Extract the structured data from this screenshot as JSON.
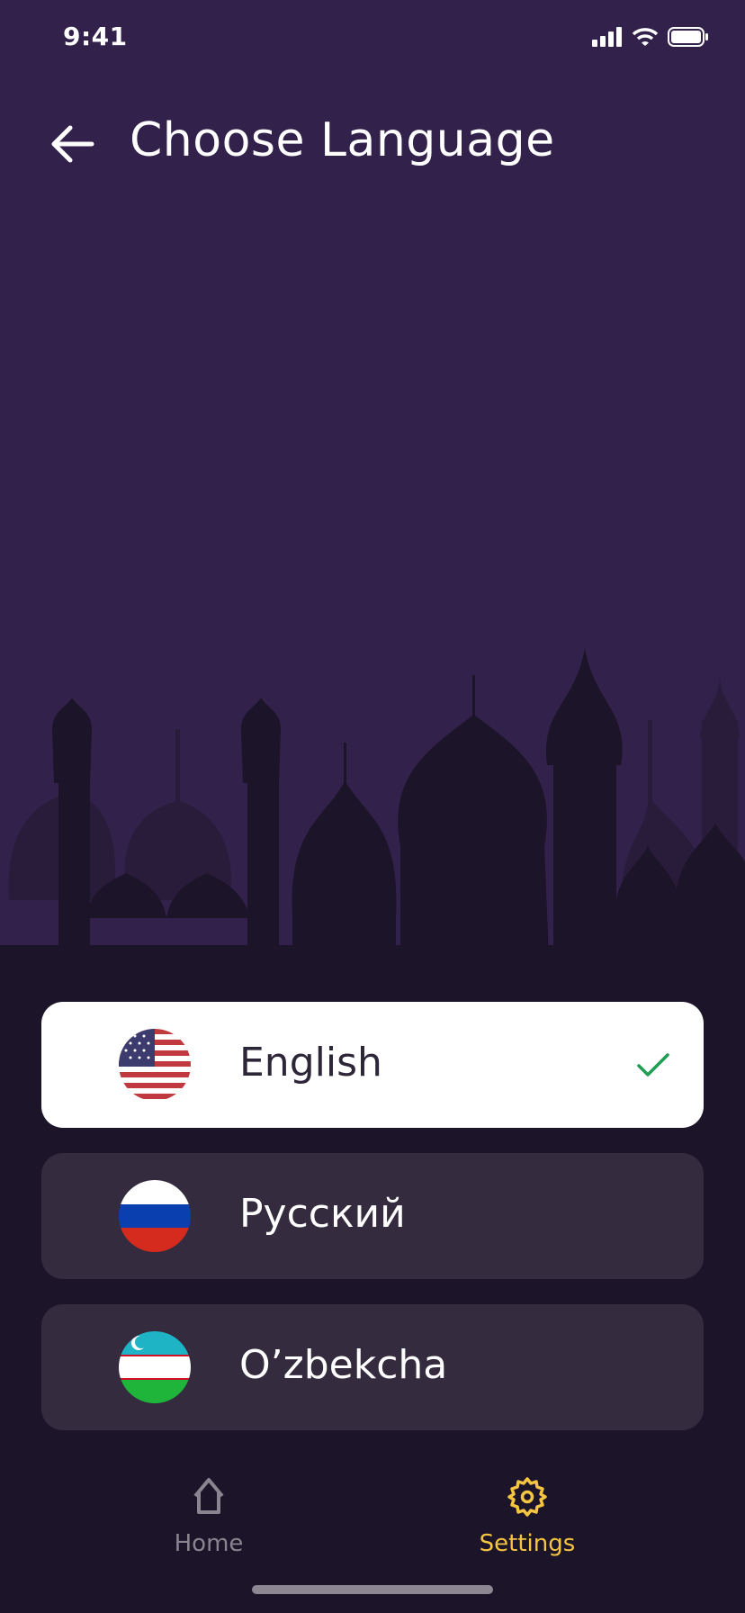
{
  "status_bar": {
    "time": "9:41"
  },
  "header": {
    "title": "Choose Language"
  },
  "languages": [
    {
      "label": "English",
      "flag": "us-flag",
      "selected": true
    },
    {
      "label": "Русский",
      "flag": "ru-flag",
      "selected": false
    },
    {
      "label": "O’zbekcha",
      "flag": "uz-flag",
      "selected": false
    }
  ],
  "bottom_nav": [
    {
      "label": "Home",
      "icon": "home-icon",
      "active": false
    },
    {
      "label": "Settings",
      "icon": "gear-icon",
      "active": true
    }
  ],
  "colors": {
    "accent": "#f5c542",
    "check": "#1f9d55",
    "bg_top": "#32214a",
    "bg_bottom": "#1c1428",
    "card": "#342b3e"
  }
}
